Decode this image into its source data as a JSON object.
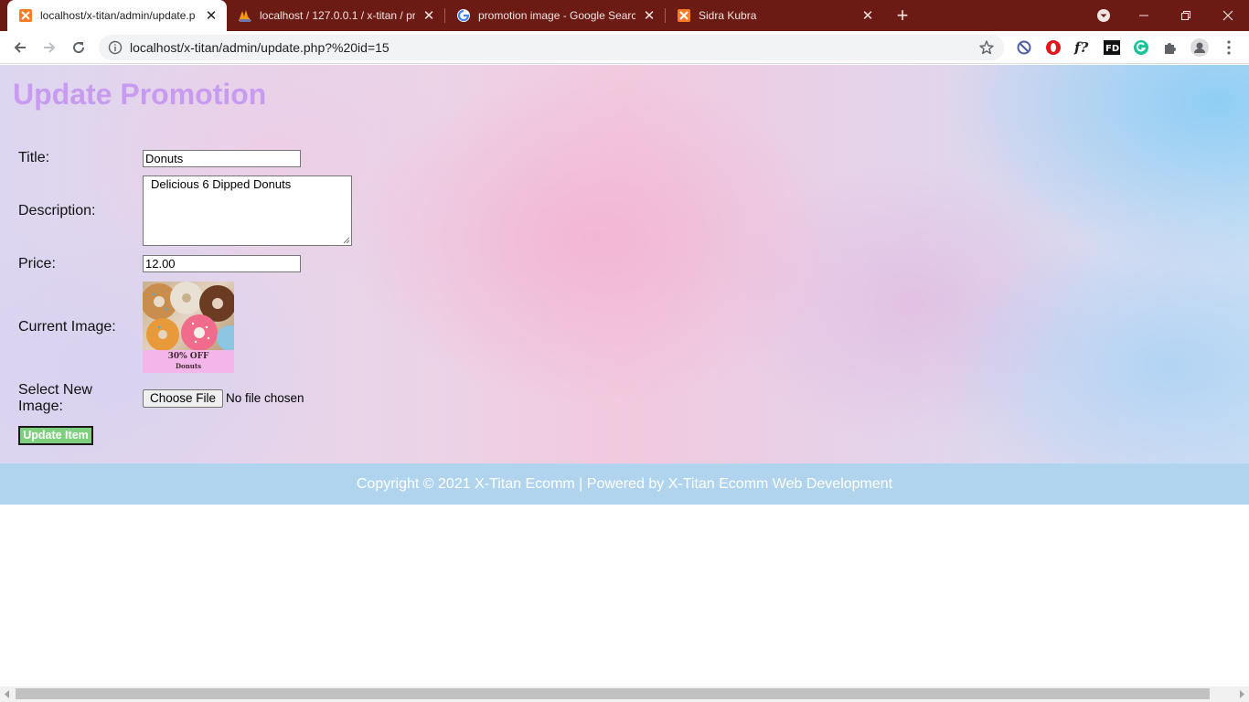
{
  "browser": {
    "tabs": [
      {
        "title": "localhost/x-titan/admin/update.p",
        "icon": "xampp-icon",
        "active": true
      },
      {
        "title": "localhost / 127.0.0.1 / x-titan / pr",
        "icon": "phpmyadmin-icon",
        "active": false
      },
      {
        "title": "promotion image - Google Searc",
        "icon": "google-icon",
        "active": false
      },
      {
        "title": "Sidra Kubra",
        "icon": "xampp-icon",
        "active": false
      }
    ],
    "address_bar": {
      "url": "localhost/x-titan/admin/update.php?%20id=15"
    },
    "extensions": [
      "block-icon",
      "opera-icon",
      "font-icon",
      "fd-icon",
      "grammarly-icon",
      "puzzle-icon",
      "profile-icon",
      "menu-icon"
    ],
    "frame_color": "#6b1a14"
  },
  "page": {
    "heading": "Update Promotion",
    "heading_color": "#c99bf0",
    "form": {
      "title_label": "Title:",
      "title_value": "Donuts",
      "description_label": "Description:",
      "description_value": "Delicious 6 Dipped Donuts",
      "price_label": "Price:",
      "price_value": "12.00",
      "current_image_label": "Current Image:",
      "current_image": {
        "text_line1": "30% OFF",
        "text_line2": "Donuts"
      },
      "new_image_label": "Select New Image:",
      "file_button": "Choose File",
      "file_status": "No file chosen",
      "submit_label": "Update Item",
      "submit_color": "#7dd07d"
    },
    "footer": {
      "text": "Copyright © 2021 X-Titan Ecomm | Powered by X-Titan Ecomm Web Development",
      "background": "#b0d4ee"
    }
  }
}
